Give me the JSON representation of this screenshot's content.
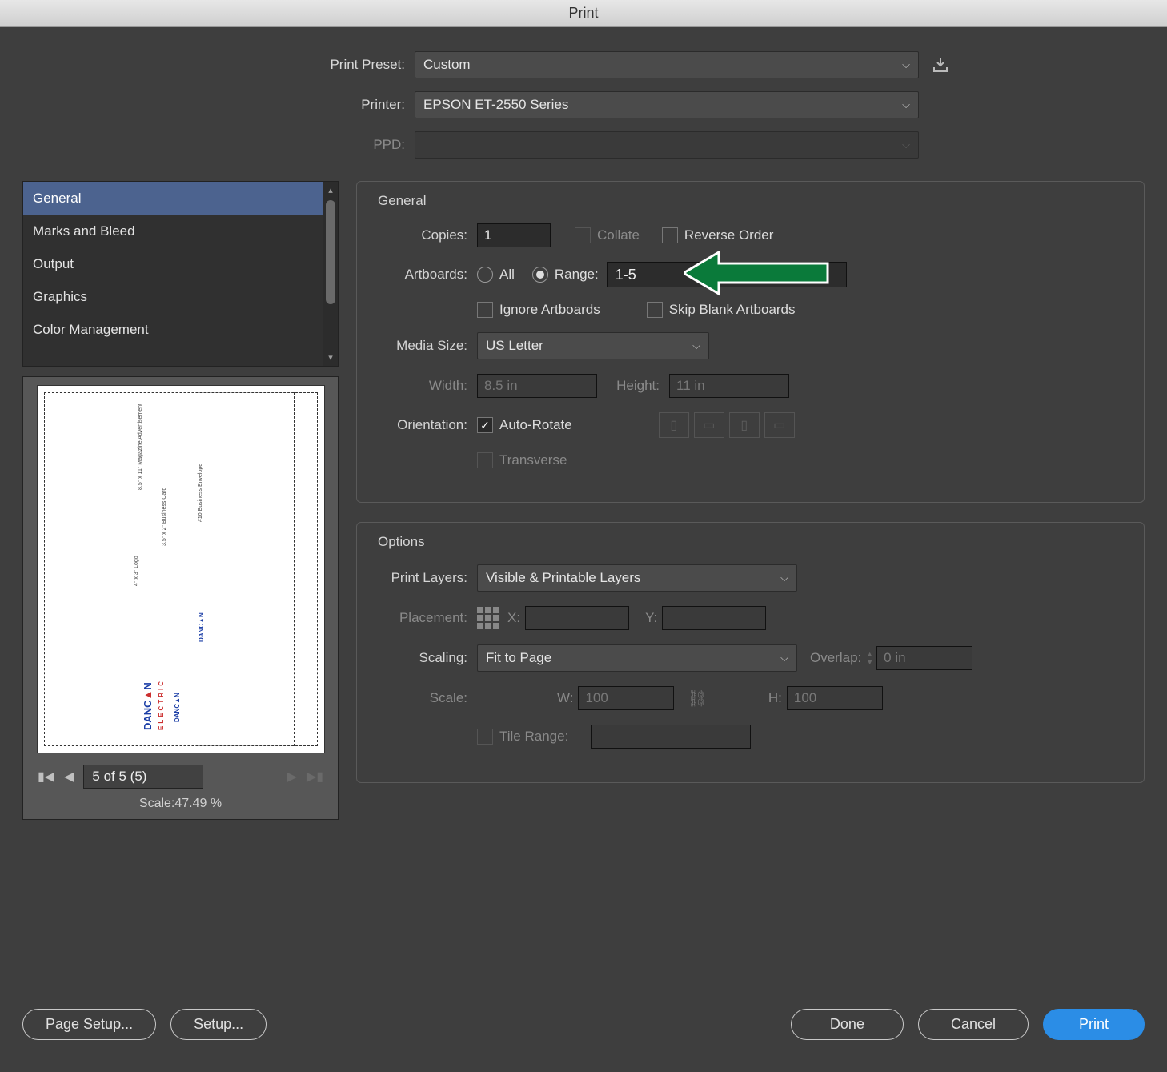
{
  "window_title": "Print",
  "preset": {
    "label": "Print Preset:",
    "value": "Custom"
  },
  "printer": {
    "label": "Printer:",
    "value": "EPSON ET-2550 Series"
  },
  "ppd": {
    "label": "PPD:",
    "value": ""
  },
  "categories": [
    "General",
    "Marks and Bleed",
    "Output",
    "Graphics",
    "Color Management"
  ],
  "preview": {
    "pager": "5 of 5 (5)",
    "scale_label": "Scale:47.49 %"
  },
  "general": {
    "title": "General",
    "copies_label": "Copies:",
    "copies_value": "1",
    "collate": "Collate",
    "reverse": "Reverse Order",
    "artboards_label": "Artboards:",
    "all": "All",
    "range_label": "Range:",
    "range_value": "1-5",
    "ignore": "Ignore Artboards",
    "skipblank": "Skip Blank Artboards",
    "mediasize_label": "Media Size:",
    "mediasize_value": "US Letter",
    "width_label": "Width:",
    "width_value": "8.5 in",
    "height_label": "Height:",
    "height_value": "11 in",
    "orientation_label": "Orientation:",
    "autorotate": "Auto-Rotate",
    "transverse": "Transverse"
  },
  "options": {
    "title": "Options",
    "printlayers_label": "Print Layers:",
    "printlayers_value": "Visible & Printable Layers",
    "placement_label": "Placement:",
    "x_label": "X:",
    "y_label": "Y:",
    "scaling_label": "Scaling:",
    "scaling_value": "Fit to Page",
    "overlap_label": "Overlap:",
    "overlap_value": "0 in",
    "scale_label": "Scale:",
    "w_label": "W:",
    "w_value": "100",
    "h_label": "H:",
    "h_value": "100",
    "tilerange": "Tile Range:"
  },
  "buttons": {
    "pagesetup": "Page Setup...",
    "setup": "Setup...",
    "done": "Done",
    "cancel": "Cancel",
    "print": "Print"
  }
}
